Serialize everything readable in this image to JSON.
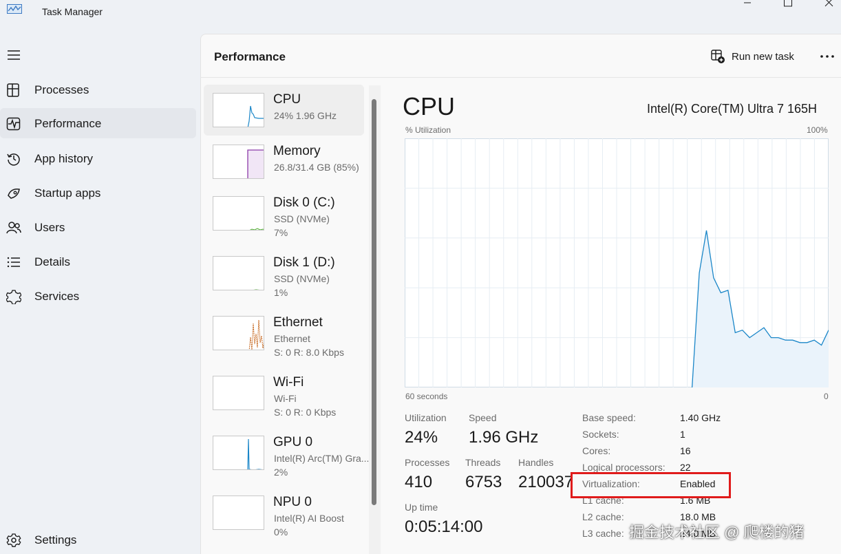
{
  "window": {
    "title": "Task Manager"
  },
  "sidebar": {
    "items": [
      {
        "label": "Processes",
        "icon": "processes-icon"
      },
      {
        "label": "Performance",
        "icon": "performance-icon",
        "active": true
      },
      {
        "label": "App history",
        "icon": "history-icon"
      },
      {
        "label": "Startup apps",
        "icon": "startup-icon"
      },
      {
        "label": "Users",
        "icon": "users-icon"
      },
      {
        "label": "Details",
        "icon": "details-icon"
      },
      {
        "label": "Services",
        "icon": "services-icon"
      }
    ],
    "settings_label": "Settings"
  },
  "header": {
    "title": "Performance",
    "run_new_task": "Run new task"
  },
  "devices": [
    {
      "name": "CPU",
      "line1": "24%  1.96 GHz",
      "line2": "",
      "color": "#1a86c8"
    },
    {
      "name": "Memory",
      "line1": "26.8/31.4 GB (85%)",
      "line2": "",
      "color": "#8b3aa8"
    },
    {
      "name": "Disk 0 (C:)",
      "line1": "SSD (NVMe)",
      "line2": "7%",
      "color": "#4cae2c"
    },
    {
      "name": "Disk 1 (D:)",
      "line1": "SSD (NVMe)",
      "line2": "1%",
      "color": "#4cae2c"
    },
    {
      "name": "Ethernet",
      "line1": "Ethernet",
      "line2": "S: 0  R: 8.0 Kbps",
      "color": "#c5641a"
    },
    {
      "name": "Wi-Fi",
      "line1": "Wi-Fi",
      "line2": "S: 0  R: 0 Kbps",
      "color": "#c5641a"
    },
    {
      "name": "GPU 0",
      "line1": "Intel(R) Arc(TM) Gra...",
      "line2": "2%",
      "color": "#1a86c8"
    },
    {
      "name": "NPU 0",
      "line1": "Intel(R) AI Boost",
      "line2": "0%",
      "color": "#1a86c8"
    }
  ],
  "cpu": {
    "title": "CPU",
    "model": "Intel(R) Core(TM) Ultra 7 165H",
    "graph_label": "% Utilization",
    "graph_max": "100%",
    "graph_time": "60 seconds",
    "graph_min": "0",
    "line_color": "#1a86c8",
    "utilization_history": [
      0,
      0,
      0,
      0,
      0,
      0,
      0,
      0,
      0,
      0,
      0,
      0,
      0,
      0,
      0,
      0,
      0,
      0,
      0,
      0,
      0,
      0,
      0,
      0,
      0,
      0,
      0,
      0,
      0,
      0,
      0,
      0,
      0,
      0,
      0,
      0,
      0,
      0,
      0,
      0,
      0,
      0,
      0,
      0,
      0,
      0,
      0,
      0,
      0,
      0,
      0,
      0,
      0,
      0,
      0,
      0,
      0,
      0,
      0,
      0,
      0,
      0,
      0,
      0,
      0,
      0,
      0,
      0,
      0,
      0,
      0,
      0,
      0,
      0,
      0,
      0,
      0,
      0,
      0,
      0,
      0,
      0,
      0,
      0,
      0,
      0,
      0,
      0,
      0,
      0,
      0,
      0,
      0,
      0,
      0,
      0,
      0,
      0,
      0,
      0,
      0,
      0,
      0,
      0,
      0,
      0,
      0,
      0,
      0,
      0,
      0,
      0,
      0,
      0,
      0,
      0,
      0,
      0,
      0,
      0,
      0,
      0,
      0,
      0,
      0,
      0,
      0,
      0,
      0,
      0,
      0,
      0,
      0,
      0,
      0,
      0,
      0,
      0,
      0,
      0,
      0,
      0,
      0,
      0,
      0,
      0,
      0,
      0,
      0,
      0,
      0,
      0,
      0,
      0,
      0,
      0,
      0,
      0,
      0,
      0,
      0,
      0,
      0,
      0,
      0,
      0,
      0,
      0,
      0,
      0,
      0,
      0,
      0,
      0,
      0,
      0,
      0,
      0,
      0,
      0,
      0,
      0,
      0,
      0
    ],
    "utilization_points": [
      {
        "t": 40,
        "v": 0
      },
      {
        "t": 41,
        "v": 46
      },
      {
        "t": 42,
        "v": 63
      },
      {
        "t": 43,
        "v": 44
      },
      {
        "t": 44,
        "v": 38
      },
      {
        "t": 45,
        "v": 39
      },
      {
        "t": 46,
        "v": 22
      },
      {
        "t": 47,
        "v": 23
      },
      {
        "t": 48,
        "v": 20
      },
      {
        "t": 49,
        "v": 22
      },
      {
        "t": 50,
        "v": 24
      },
      {
        "t": 51,
        "v": 20
      },
      {
        "t": 52,
        "v": 20
      },
      {
        "t": 53,
        "v": 19
      },
      {
        "t": 54,
        "v": 19
      },
      {
        "t": 55,
        "v": 18
      },
      {
        "t": 56,
        "v": 18
      },
      {
        "t": 57,
        "v": 19
      },
      {
        "t": 58,
        "v": 17
      },
      {
        "t": 59,
        "v": 23
      }
    ],
    "stats": {
      "utilization_label": "Utilization",
      "utilization": "24%",
      "speed_label": "Speed",
      "speed": "1.96 GHz",
      "processes_label": "Processes",
      "processes": "410",
      "threads_label": "Threads",
      "threads": "6753",
      "handles_label": "Handles",
      "handles": "210037",
      "uptime_label": "Up time",
      "uptime": "0:05:14:00"
    },
    "specs": [
      {
        "label": "Base speed:",
        "value": "1.40 GHz"
      },
      {
        "label": "Sockets:",
        "value": "1"
      },
      {
        "label": "Cores:",
        "value": "16"
      },
      {
        "label": "Logical processors:",
        "value": "22"
      },
      {
        "label": "Virtualization:",
        "value": "Enabled"
      },
      {
        "label": "L1 cache:",
        "value": "1.6 MB"
      },
      {
        "label": "L2 cache:",
        "value": "18.0 MB"
      },
      {
        "label": "L3 cache:",
        "value": "24.0 MB"
      }
    ]
  },
  "watermark": "掘金技术社区 @ 爬楼的猪"
}
